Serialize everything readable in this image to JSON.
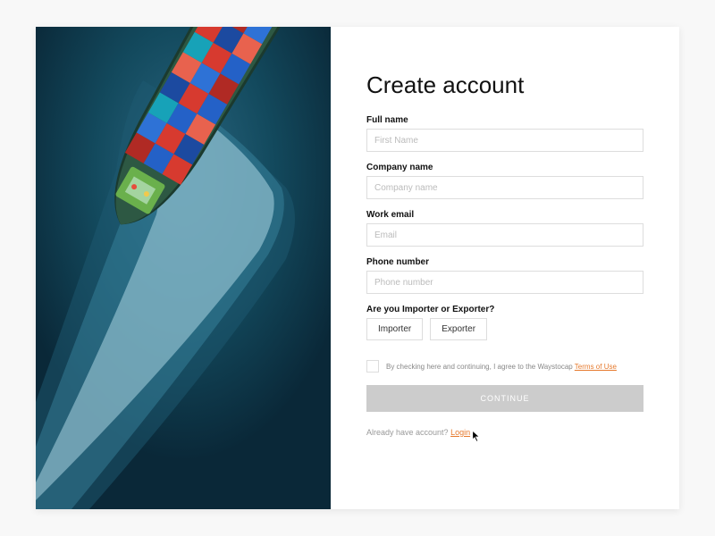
{
  "title": "Create account",
  "fields": {
    "full_name": {
      "label": "Full name",
      "placeholder": "First Name"
    },
    "company": {
      "label": "Company name",
      "placeholder": "Company name"
    },
    "email": {
      "label": "Work email",
      "placeholder": "Email"
    },
    "phone": {
      "label": "Phone number",
      "placeholder": "Phone number"
    },
    "role": {
      "label": "Are you Importer or Exporter?",
      "options": [
        "Importer",
        "Exporter"
      ]
    }
  },
  "terms": {
    "prefix": "By checking here and continuing, I agree to the Waystocap ",
    "link": "Terms of Use"
  },
  "continue_label": "CONTINUE",
  "login": {
    "prefix": "Already have account? ",
    "link": "Login"
  }
}
